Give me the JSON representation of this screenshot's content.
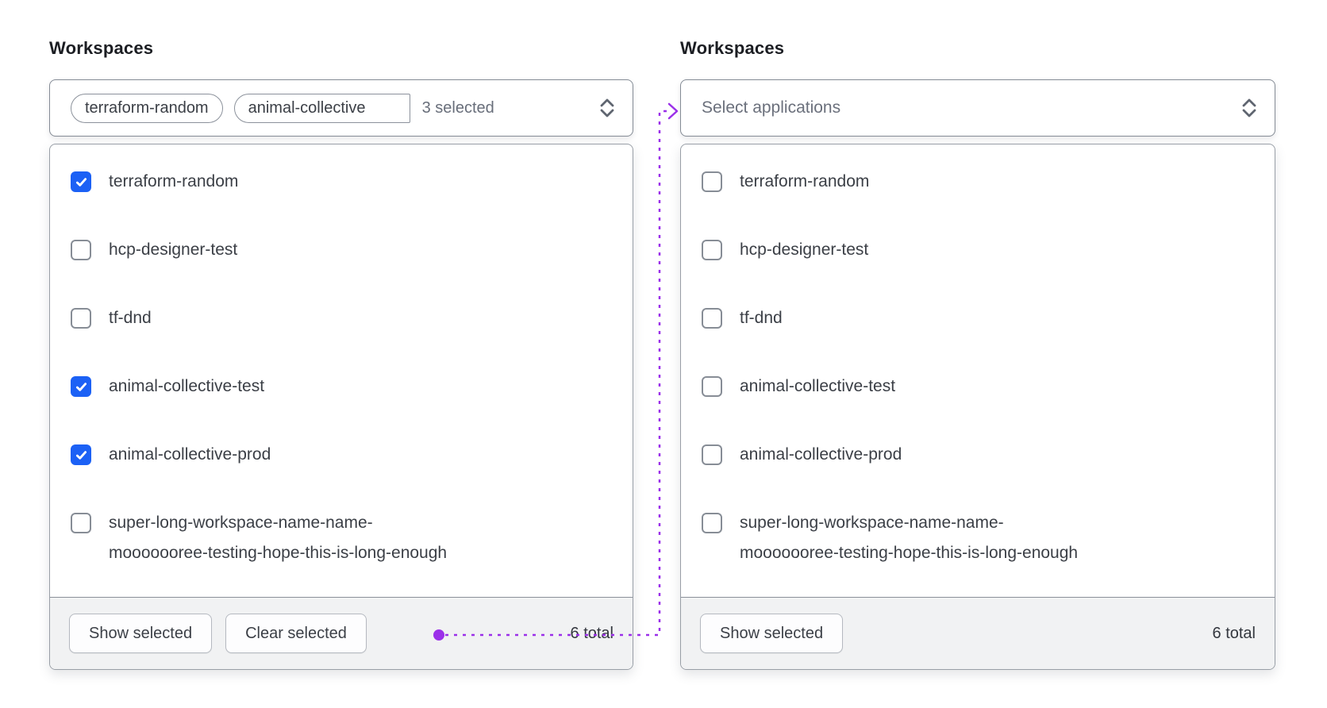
{
  "colors": {
    "checkbox_checked": "#1c61f5",
    "annotation_purple": "#9b30e9",
    "footer_bg": "#f1f2f3",
    "border_strong": "#848b95"
  },
  "left_select": {
    "label": "Workspaces",
    "trigger": {
      "tags": [
        "terraform-random",
        "animal-collective"
      ],
      "count_label": "3 selected",
      "chevron_icon": "caret-up-down"
    },
    "options": [
      {
        "label": "terraform-random",
        "checked": true
      },
      {
        "label": "hcp-designer-test",
        "checked": false
      },
      {
        "label": "tf-dnd",
        "checked": false
      },
      {
        "label": "animal-collective-test",
        "checked": true
      },
      {
        "label": "animal-collective-prod",
        "checked": true
      },
      {
        "label": "super-long-workspace-name-name-\nmooooooree-testing-hope-this-is-long-enough",
        "checked": false
      }
    ],
    "footer": {
      "show_selected": "Show selected",
      "clear_selected": "Clear selected",
      "total": "6 total"
    }
  },
  "right_select": {
    "label": "Workspaces",
    "trigger": {
      "placeholder": "Select applications",
      "chevron_icon": "caret-up-down"
    },
    "options": [
      {
        "label": "terraform-random",
        "checked": false
      },
      {
        "label": "hcp-designer-test",
        "checked": false
      },
      {
        "label": "tf-dnd",
        "checked": false
      },
      {
        "label": "animal-collective-test",
        "checked": false
      },
      {
        "label": "animal-collective-prod",
        "checked": false
      },
      {
        "label": "super-long-workspace-name-name-\nmooooooree-testing-hope-this-is-long-enough",
        "checked": false
      }
    ],
    "footer": {
      "show_selected": "Show selected",
      "total": "6 total"
    }
  }
}
